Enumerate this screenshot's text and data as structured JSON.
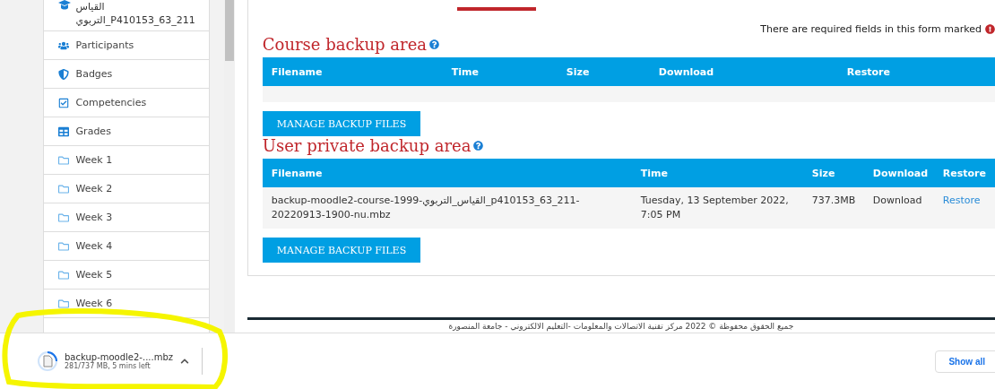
{
  "sidebar": {
    "course": {
      "line_1": "القياس",
      "line_2": "التربوي_P410153_63_211"
    },
    "items": [
      {
        "kind": "participants",
        "label": "Participants"
      },
      {
        "kind": "badges",
        "label": "Badges"
      },
      {
        "kind": "competencies",
        "label": "Competencies"
      },
      {
        "kind": "grades",
        "label": "Grades"
      },
      {
        "kind": "folder",
        "label": "Week 1"
      },
      {
        "kind": "folder",
        "label": "Week 2"
      },
      {
        "kind": "folder",
        "label": "Week 3"
      },
      {
        "kind": "folder",
        "label": "Week 4"
      },
      {
        "kind": "folder",
        "label": "Week 5"
      },
      {
        "kind": "folder",
        "label": "Week 6"
      }
    ]
  },
  "required_note": "There are required fields in this form marked",
  "sections": [
    {
      "title": "Course backup area",
      "columns": [
        "Filename",
        "Time",
        "Size",
        "Download",
        "Restore"
      ],
      "button": "MANAGE BACKUP FILES"
    },
    {
      "title": "User private backup area",
      "columns": [
        "Filename",
        "Time",
        "Size",
        "Download",
        "Restore"
      ],
      "rows": [
        {
          "filename": "backup-moodle2-course-1999-القياس_التربوي_p410153_63_211-20220913-1900-nu.mbz",
          "time": "Tuesday, 13 September 2022, 7:05 PM",
          "size": "737.3MB",
          "download": "Download",
          "restore": "Restore"
        }
      ],
      "button": "MANAGE BACKUP FILES"
    }
  ],
  "footer": "جميع الحقوق محفوظة © 2022 مركز تقنية الاتصالات والمعلومات -التعليم الالكتروني - جامعة المنصورة",
  "download_bar": {
    "filename": "backup-moodle2-....mbz",
    "status": "281/737 MB, 5 mins left",
    "show_all": "Show all"
  }
}
